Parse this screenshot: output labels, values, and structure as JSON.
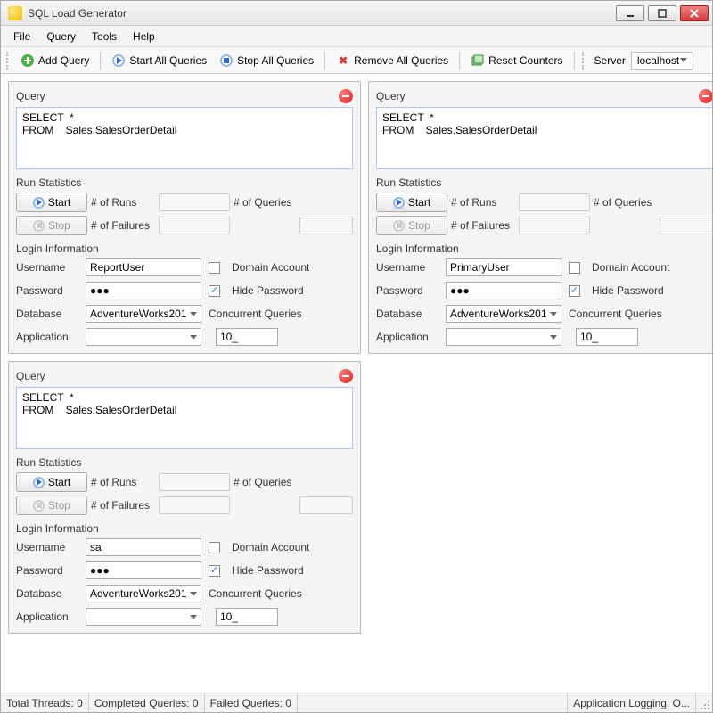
{
  "window": {
    "title": "SQL Load Generator"
  },
  "menubar": {
    "items": [
      "File",
      "Query",
      "Tools",
      "Help"
    ]
  },
  "toolbar": {
    "add_query": "Add Query",
    "start_all": "Start All Queries",
    "stop_all": "Stop All Queries",
    "remove_all": "Remove All Queries",
    "reset_counters": "Reset Counters",
    "server_label": "Server",
    "server_value": "localhost"
  },
  "labels": {
    "query": "Query",
    "run_stats": "Run Statistics",
    "start": "Start",
    "stop": "Stop",
    "num_runs": "# of Runs",
    "num_queries": "# of Queries",
    "num_failures": "# of Failures",
    "login_info": "Login Information",
    "username": "Username",
    "password": "Password",
    "database": "Database",
    "application": "Application",
    "domain_account": "Domain Account",
    "hide_password": "Hide Password",
    "concurrent_queries": "Concurrent Queries"
  },
  "panels": [
    {
      "sql": "SELECT  *\nFROM    Sales.SalesOrderDetail",
      "username": "ReportUser",
      "password": "●●●",
      "database": "AdventureWorks201",
      "application": "",
      "domain_account": false,
      "hide_password": true,
      "concurrent": "10_"
    },
    {
      "sql": "SELECT  *\nFROM    Sales.SalesOrderDetail",
      "username": "PrimaryUser",
      "password": "●●●",
      "database": "AdventureWorks201",
      "application": "",
      "domain_account": false,
      "hide_password": true,
      "concurrent": "10_"
    },
    {
      "sql": "SELECT  *\nFROM    Sales.SalesOrderDetail",
      "username": "sa",
      "password": "●●●",
      "database": "AdventureWorks201",
      "application": "",
      "domain_account": false,
      "hide_password": true,
      "concurrent": "10_"
    }
  ],
  "status": {
    "total_threads": "Total Threads:  0",
    "completed": "Completed Queries:  0",
    "failed": "Failed Queries:  0",
    "logging": "Application Logging: O..."
  }
}
